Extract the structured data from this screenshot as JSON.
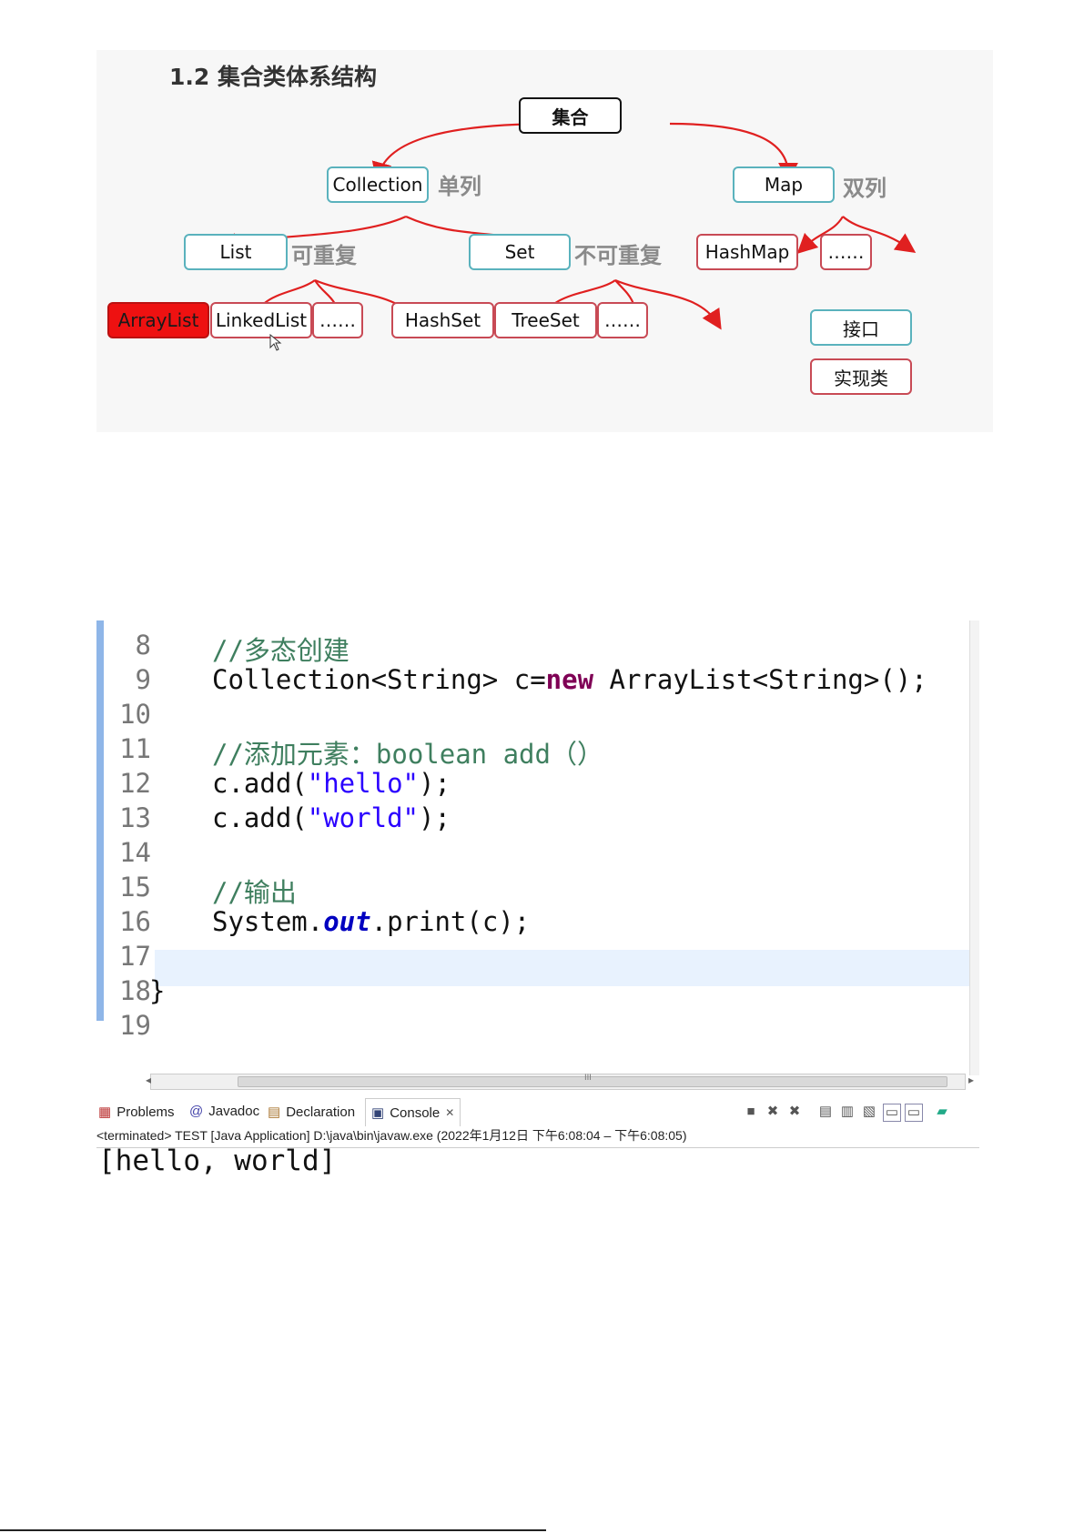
{
  "diagram": {
    "title": "1.2 集合类体系结构",
    "root": "集合",
    "collection": "Collection",
    "collection_tag": "单列",
    "map": "Map",
    "map_tag": "双列",
    "list": "List",
    "list_tag": "可重复",
    "set": "Set",
    "set_tag": "不可重复",
    "hashmap": "HashMap",
    "map_more": "……",
    "arraylist": "ArrayList",
    "linkedlist": "LinkedList",
    "list_more": "……",
    "hashset": "HashSet",
    "treeset": "TreeSet",
    "set_more": "……",
    "legend_interface": "接口",
    "legend_impl": "实现类",
    "colors": {
      "interface_border": "#5ab2bd",
      "impl_border": "#c84a55",
      "arrow": "#e02020",
      "highlight": "#ee1111"
    }
  },
  "editor": {
    "line_numbers": [
      "8",
      "9",
      "10",
      "11",
      "12",
      "13",
      "14",
      "15",
      "16",
      "17",
      "18",
      "19"
    ],
    "line8": "//多态创建",
    "line9_a": "Collection<String> c=",
    "line9_kw": "new",
    "line9_b": " ArrayList<String>();",
    "line11": "//添加元素：boolean add（）",
    "line12_a": "c.add(",
    "line12_str": "\"hello\"",
    "line12_b": ");",
    "line13_a": "c.add(",
    "line13_str": "\"world\"",
    "line13_b": ");",
    "line15": "//输出",
    "line16_a": "System.",
    "line16_fld": "out",
    "line16_b": ".print(c);",
    "line18": "}",
    "scroll_grip": "III"
  },
  "console": {
    "tabs": [
      "Problems",
      "Javadoc",
      "Declaration",
      "Console"
    ],
    "tab_icons": [
      "problems-icon",
      "javadoc-icon",
      "declaration-icon",
      "console-icon"
    ],
    "close_glyph": "✕",
    "status": "<terminated> TEST [Java Application] D:\\java\\bin\\javaw.exe  (2022年1月12日 下午6:08:04 – 下午6:08:05)",
    "output": "[hello, world]"
  }
}
